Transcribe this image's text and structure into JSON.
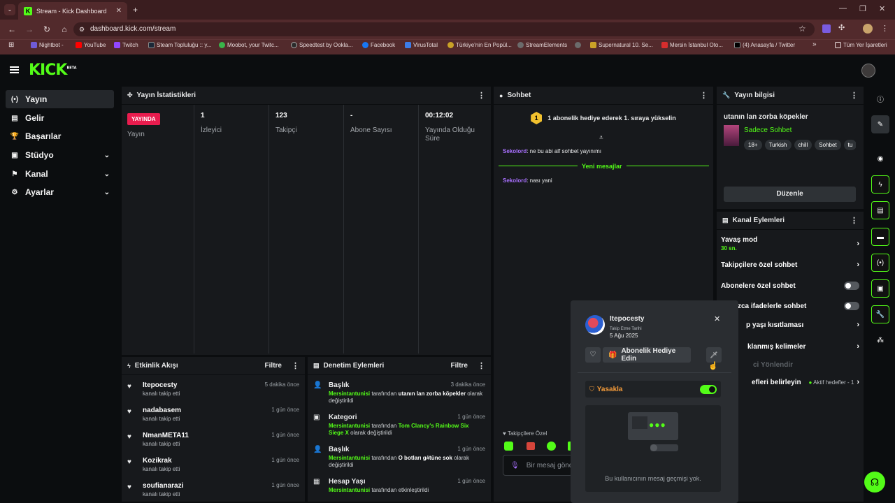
{
  "browser": {
    "tab_title": "Stream - Kick Dashboard",
    "url": "dashboard.kick.com/stream",
    "bookmarks": [
      "Nightbot -",
      "YouTube",
      "Twitch",
      "Steam Topluluğu :: y...",
      "Moobot, your Twitc...",
      "Speedtest by Ookla...",
      "Facebook",
      "VirusTotal",
      "Türkiye'nin En Popül...",
      "StreamElements",
      "",
      "Supernatural 10. Se...",
      "Mersin İstanbul Oto...",
      "(4) Anasayfa / Twitter"
    ],
    "bookmarks_more": "»",
    "bookmarks_folder": "Tüm Yer İşaretleri",
    "bookmark_colors": [
      "#6f5bd6",
      "#ff0000",
      "#9146ff",
      "#1b2838",
      "#39b54a",
      "#2b2b2b",
      "#1877f2",
      "#3d7de8",
      "#c9a227",
      "#6b6b6b",
      "#6b6b6b",
      "#c9a227",
      "#d62d2d",
      "#000000"
    ]
  },
  "app": {
    "logo": "KICK",
    "logo_badge": "BETA",
    "colors": {
      "accent": "#53fc18",
      "live": "#e91c4e",
      "username": "#a970ff"
    }
  },
  "sidebar": {
    "items": [
      {
        "label": "Yayın",
        "icon": "(•)"
      },
      {
        "label": "Gelir",
        "icon": "▤"
      },
      {
        "label": "Başarılar",
        "icon": "🏆"
      },
      {
        "label": "Stüdyo",
        "icon": "▣"
      },
      {
        "label": "Kanal",
        "icon": "⚑"
      },
      {
        "label": "Ayarlar",
        "icon": "⚙"
      }
    ]
  },
  "stats": {
    "title": "Yayın İstatistikleri",
    "live_badge": "YAYINDA",
    "live_label": "Yayın",
    "items": [
      {
        "value": "1",
        "label": "İzleyici"
      },
      {
        "value": "123",
        "label": "Takipçi"
      },
      {
        "value": "-",
        "label": "Abone Sayısı"
      },
      {
        "value": "00:12:02",
        "label": "Yayında Olduğu Süre"
      }
    ]
  },
  "chat": {
    "title": "Sohbet",
    "banner_number": "1",
    "banner": "1 abonelik hediye ederek 1. sıraya yükselin",
    "messages": [
      {
        "user": "Sekolord",
        "text": ": ne bu abi alf sohbet yayınımı"
      },
      {
        "user": "Sekolord",
        "text": ": nası yani"
      }
    ],
    "new_messages": "Yeni mesajlar",
    "followers_only": "Takipçilere Özel",
    "input_placeholder": "Bir mesaj gönder"
  },
  "stream_info": {
    "title": "Yayın bilgisi",
    "stream_title": "utanın lan zorba köpekler",
    "category": "Sadece Sohbet",
    "tags": [
      "18+",
      "Turkish",
      "chill",
      "Sohbet",
      "tu"
    ],
    "edit_button": "Düzenle"
  },
  "channel_actions": {
    "title": "Kanal Eylemleri",
    "slow_mode": "Yavaş mod",
    "slow_mode_value": "30 sn.",
    "followers_chat": "Takipçilere özel sohbet",
    "subscribers_chat": "Abonelere özel sohbet",
    "emotes_chat": "zca ifadelerle sohbet",
    "age_restriction": "p yaşı kısıtlaması",
    "banned_words": "klanmış kelimeler",
    "redirect": "ci Yönlendir",
    "goals": "efleri belirleyin",
    "goals_status": "Aktif hedefler - 1"
  },
  "activity": {
    "title": "Etkinlik Akışı",
    "filter": "Filtre",
    "items": [
      {
        "name": "Itepocesty",
        "sub": "kanalı takip etti",
        "time": "5 dakika önce"
      },
      {
        "name": "nadabasem",
        "sub": "kanalı takip etti",
        "time": "1 gün önce"
      },
      {
        "name": "NmanMETA11",
        "sub": "kanalı takip etti",
        "time": "1 gün önce"
      },
      {
        "name": "Kozikrak",
        "sub": "kanalı takip etti",
        "time": "1 gün önce"
      },
      {
        "name": "soufianarazi",
        "sub": "kanalı takip etti",
        "time": "1 gün önce"
      }
    ]
  },
  "moderation": {
    "title": "Denetim Eylemleri",
    "filter": "Filtre",
    "items": [
      {
        "name": "Başlık",
        "user": "Mersintantunisi",
        "mid": " tarafından ",
        "bold": "utanın lan zorba köpekler",
        "rest": " olarak değiştirildi",
        "time": "3 dakika önce"
      },
      {
        "name": "Kategori",
        "user": "Mersintantunisi",
        "mid": " tarafından ",
        "bold": "Tom Clancy's Rainbow Six Siege X",
        "rest": " olarak değiştirildi",
        "time": "1 gün önce"
      },
      {
        "name": "Başlık",
        "user": "Mersintantunisi",
        "mid": " tarafından ",
        "bold": "O botları g#tüne sok",
        "rest": " olarak değiştirildi",
        "time": "1 gün önce"
      },
      {
        "name": "Hesap Yaşı",
        "user": "Mersintantunisi",
        "mid": " tarafından etkinleştirildi",
        "bold": "",
        "rest": "",
        "time": "1 gün önce"
      }
    ]
  },
  "user_card": {
    "username": "Itepocesty",
    "follow_label": "Takip Etme Tarihi",
    "follow_date": "5 Ağu 2025",
    "gift_button": "Abonelik Hediye Edin",
    "ban_label": "Yasakla",
    "no_history": "Bu kullanıcının mesaj geçmişi yok."
  }
}
